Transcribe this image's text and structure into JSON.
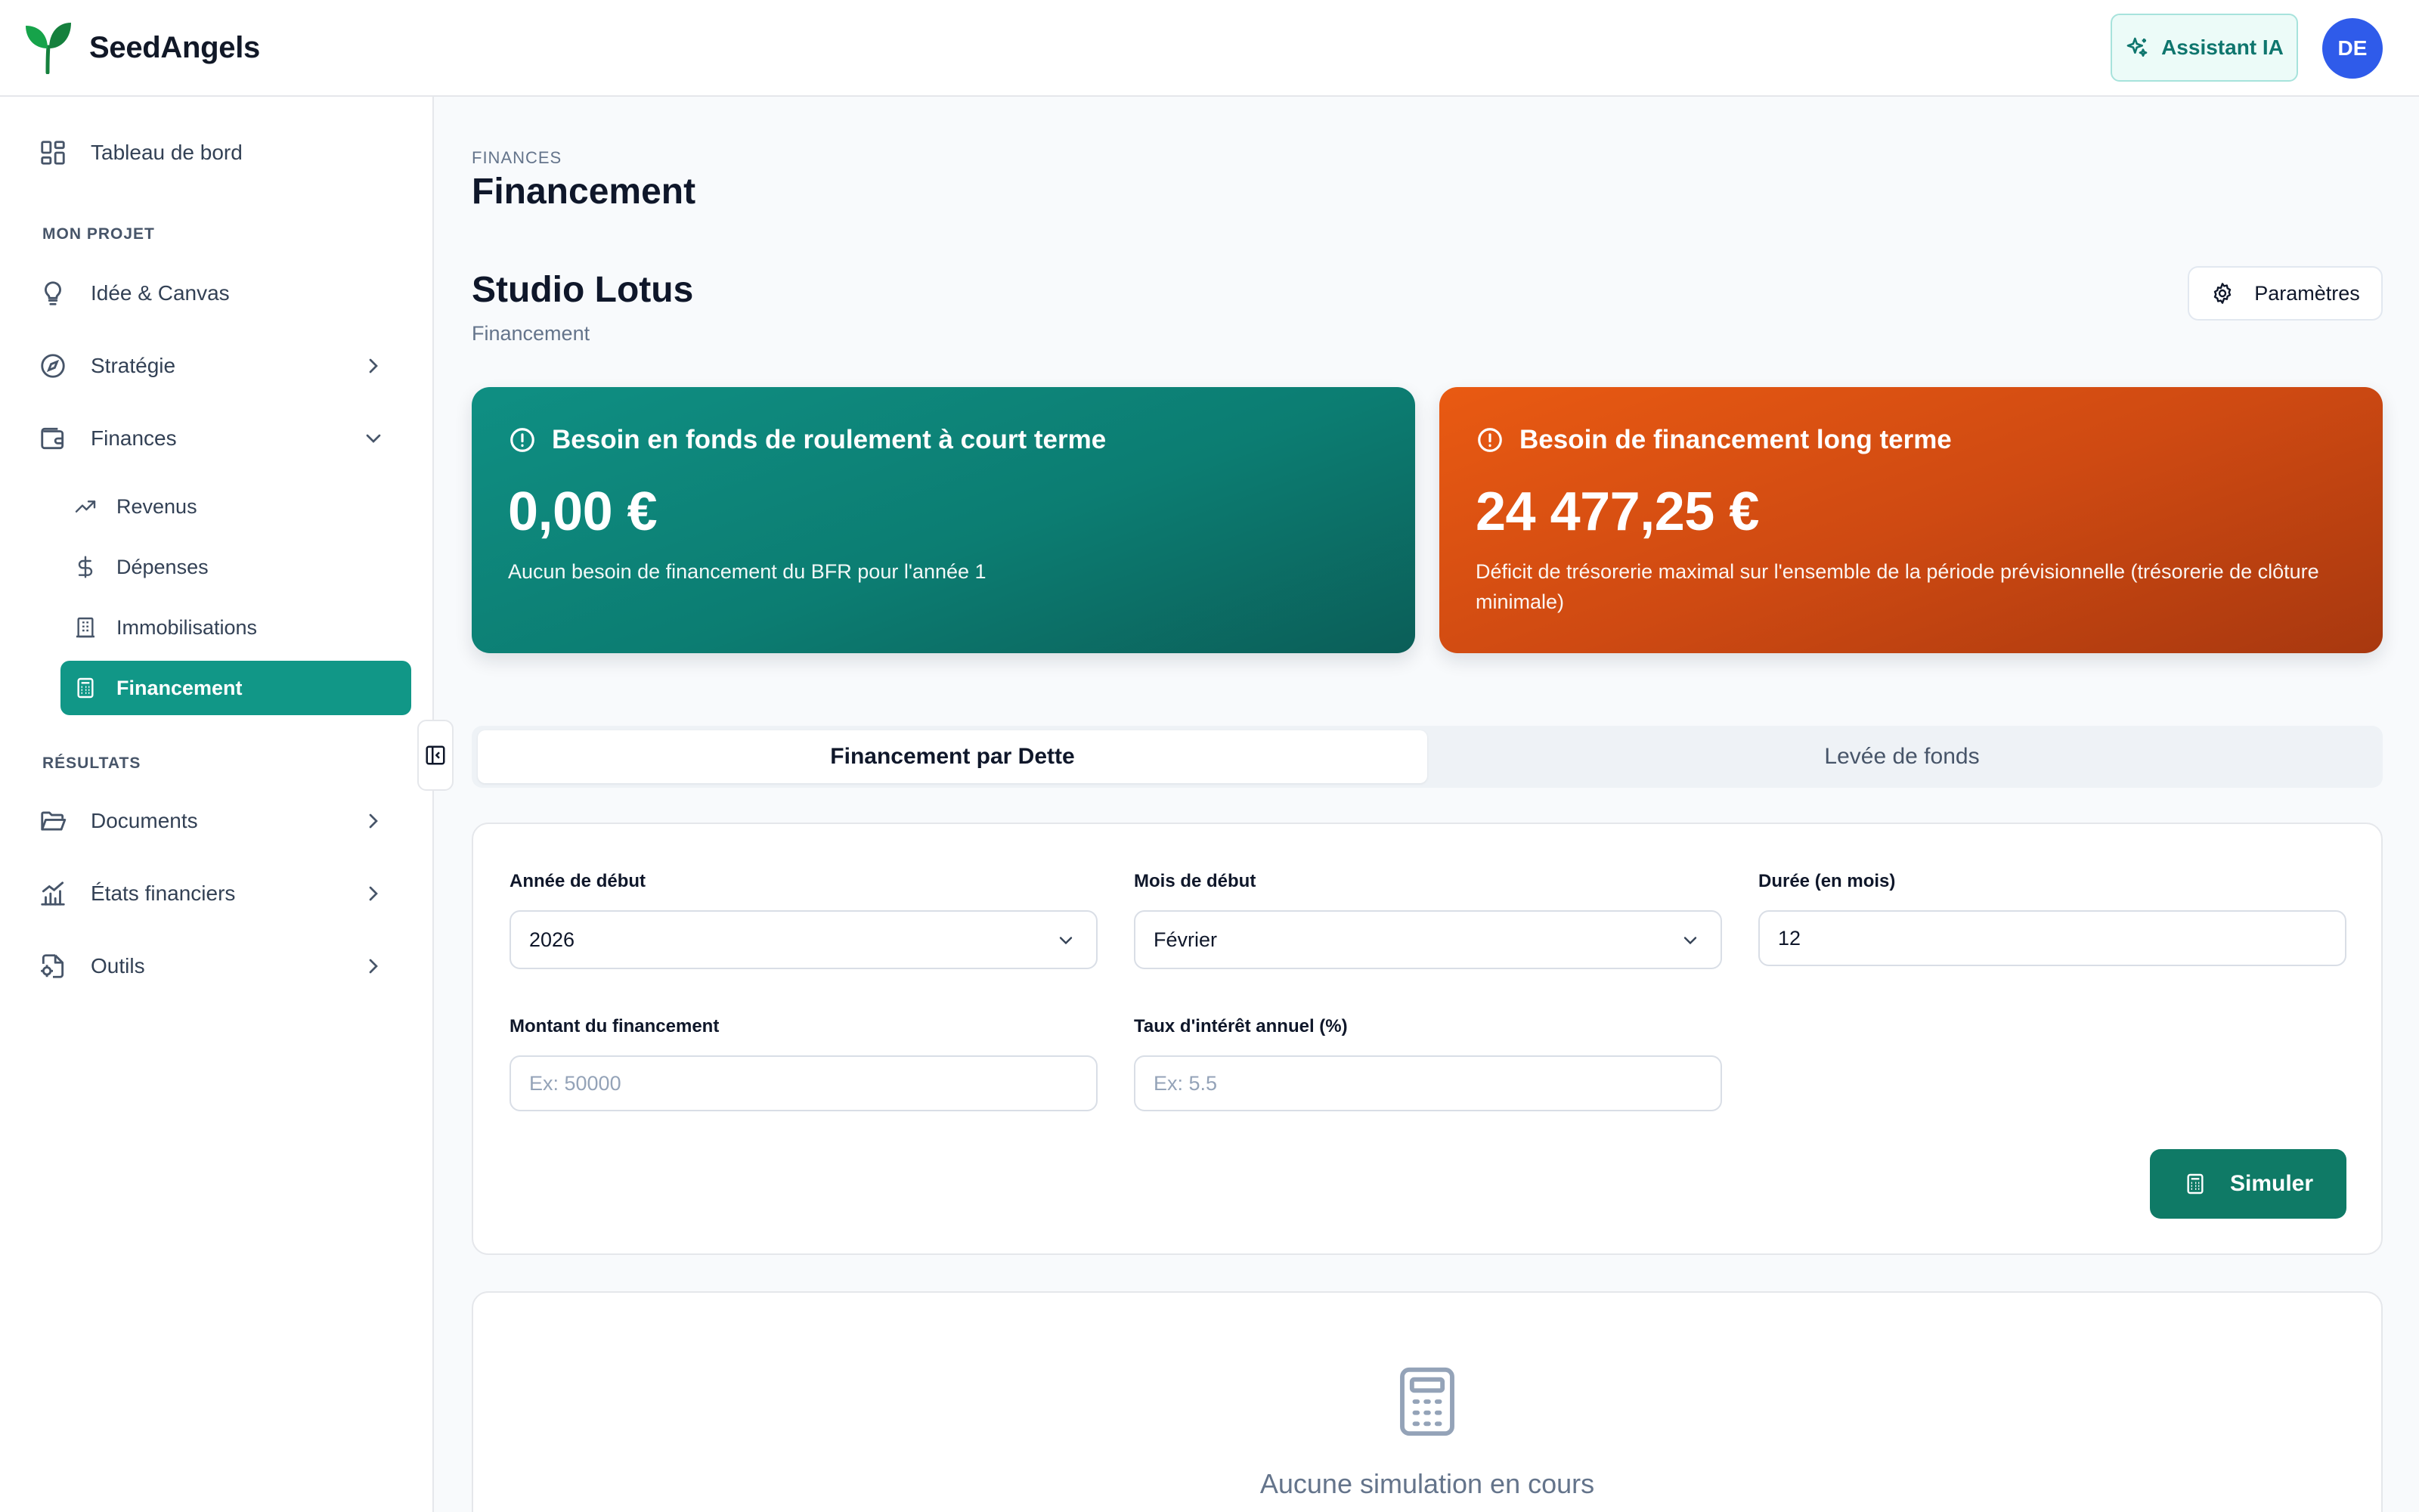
{
  "app": {
    "name": "SeedAngels",
    "assistant_label": "Assistant IA",
    "avatar_initials": "DE",
    "brand_color": "#119787"
  },
  "sidebar": {
    "dashboard": "Tableau de bord",
    "section_project": "MON PROJET",
    "idea": "Idée & Canvas",
    "strategy": "Stratégie",
    "finances": "Finances",
    "finance_items": [
      "Revenus",
      "Dépenses",
      "Immobilisations",
      "Financement"
    ],
    "active_item": "Financement",
    "section_results": "RÉSULTATS",
    "documents": "Documents",
    "statements": "États financiers",
    "tools": "Outils"
  },
  "header": {
    "breadcrumb": "FINANCES",
    "title": "Financement",
    "project_name": "Studio Lotus",
    "project_subtitle": "Financement",
    "settings_label": "Paramètres"
  },
  "kpis": {
    "short_term": {
      "title": "Besoin en fonds de roulement à court terme",
      "value": "0,00 €",
      "description": "Aucun besoin de financement du BFR pour l'année 1",
      "color": "#0f8f83"
    },
    "long_term": {
      "title": "Besoin de financement long terme",
      "value": "24 477,25 €",
      "description": "Déficit de trésorerie maximal sur l'ensemble de la période prévisionnelle (trésorerie de clôture minimale)",
      "color": "#e95a12"
    }
  },
  "tabs": {
    "debt": "Financement par Dette",
    "fundraising": "Levée de fonds",
    "active": "Financement par Dette"
  },
  "form": {
    "start_year_label": "Année de début",
    "start_year_value": "2026",
    "start_month_label": "Mois de début",
    "start_month_value": "Février",
    "duration_label": "Durée (en mois)",
    "duration_value": "12",
    "amount_label": "Montant du financement",
    "amount_placeholder": "Ex: 50000",
    "rate_label": "Taux d'intérêt annuel (%)",
    "rate_placeholder": "Ex: 5.5",
    "simulate_label": "Simuler"
  },
  "empty_state": {
    "message": "Aucune simulation en cours"
  }
}
